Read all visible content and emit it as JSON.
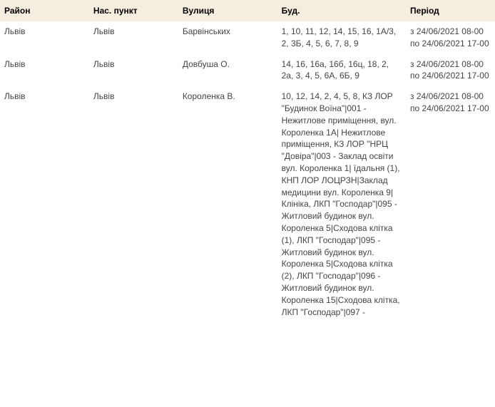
{
  "headers": {
    "district": "Район",
    "settlement": "Нас. пункт",
    "street": "Вулиця",
    "buildings": "Буд.",
    "period": "Період"
  },
  "rows": [
    {
      "district": "Львів",
      "settlement": "Львів",
      "street": "Барвінських",
      "buildings": "1, 10, 11, 12, 14, 15, 16, 1А/3, 2, 3Б, 4, 5, 6, 7, 8, 9",
      "period": "з 24/06/2021 08-00 по 24/06/2021 17-00"
    },
    {
      "district": "Львів",
      "settlement": "Львів",
      "street": "Довбуша О.",
      "buildings": "14, 16, 16а, 16б, 16ц, 18, 2, 2а, 3, 4, 5, 6А, 6Б, 9",
      "period": "з 24/06/2021 08-00 по 24/06/2021 17-00"
    },
    {
      "district": "Львів",
      "settlement": "Львів",
      "street": "Короленка В.",
      "buildings": "10, 12, 14, 2, 4, 5, 8, КЗ ЛОР \"Будинок Воїна\"|001 - Нежитлове приміщення, вул. Короленка 1А| Нежитлове приміщення, КЗ ЛОР \"НРЦ \"Довіра\"|003 - Заклад освіти вул. Короленка 1| їдальня (1), КНП ЛОР ЛОЦРЗН|Заклад медицини вул. Короленка 9|Клініка, ЛКП \"Господар\"|095 - Житловий будинок вул. Короленка 5|Сходова клітка (1), ЛКП \"Господар\"|095 - Житловий будинок вул. Короленка 5|Сходова клітка (2), ЛКП \"Господар\"|096 - Житловий будинок вул. Короленка 15|Сходова клітка, ЛКП \"Господар\"|097 -",
      "period": "з 24/06/2021 08-00 по 24/06/2021 17-00"
    }
  ]
}
